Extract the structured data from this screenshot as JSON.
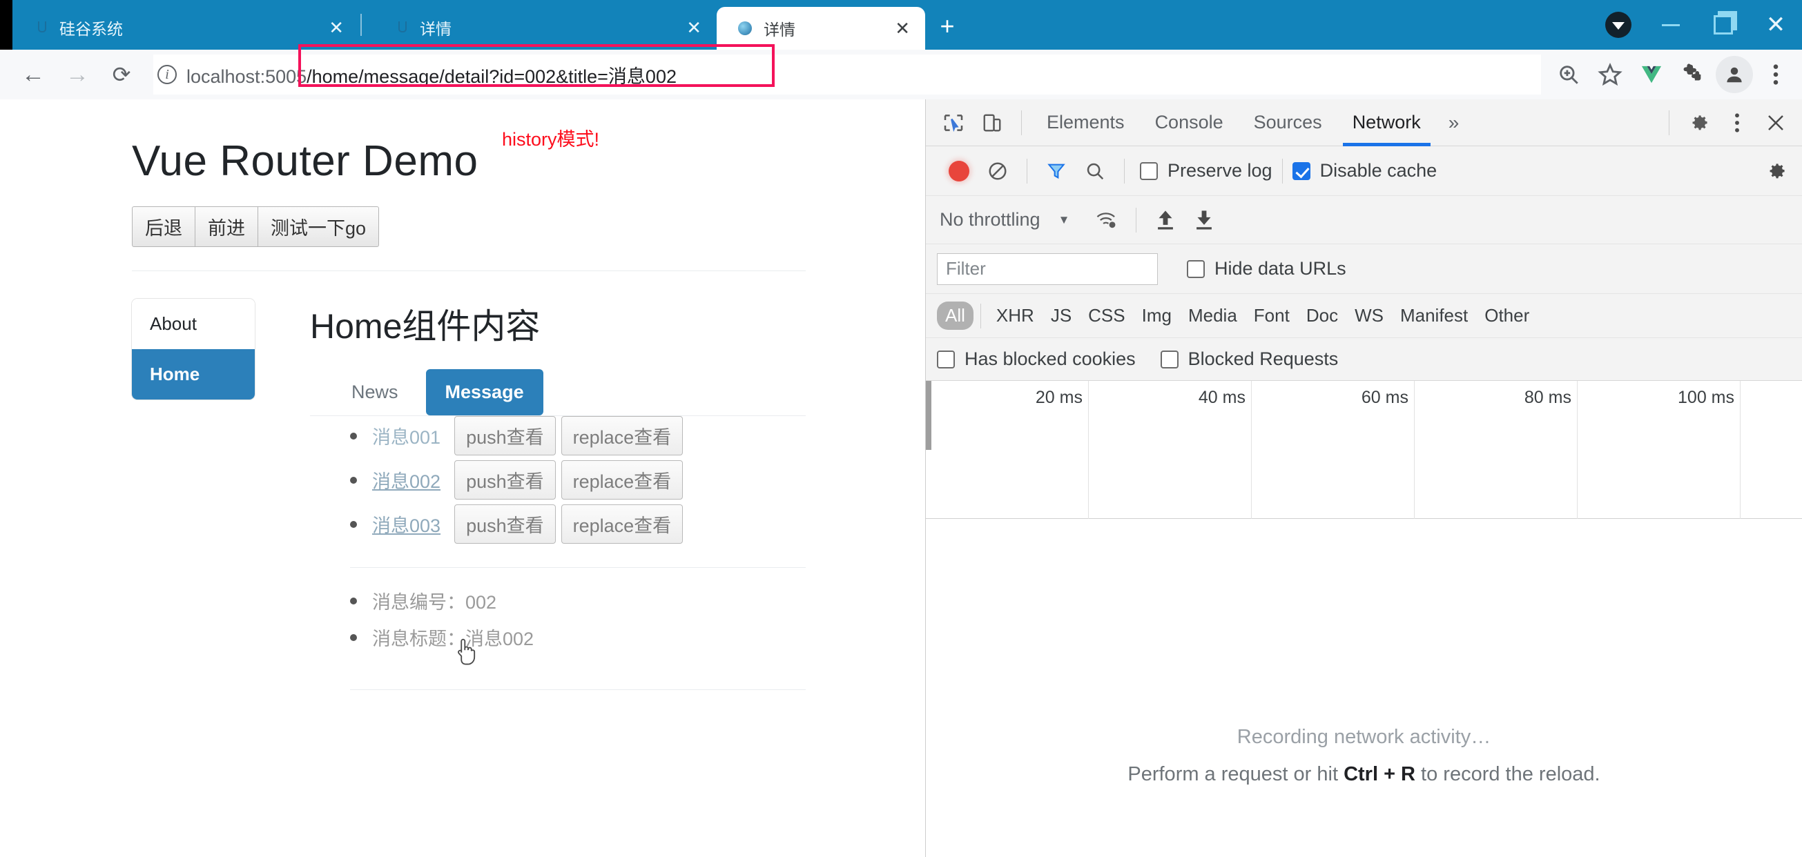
{
  "browser": {
    "tabs": [
      {
        "title": "硅谷系统",
        "favicon": "u-logo-icon",
        "active": false,
        "close_label": "✕"
      },
      {
        "title": "详情",
        "favicon": "u-logo-icon",
        "active": false,
        "close_label": "✕"
      },
      {
        "title": "详情",
        "favicon": "globe-icon",
        "active": true,
        "close_label": "✕"
      }
    ],
    "new_tab_label": "+",
    "window_controls": {
      "minimize": "—",
      "maximize": "❐",
      "close": "✕"
    },
    "nav": {
      "back": "←",
      "forward": "→",
      "reload": "⟳"
    },
    "omnibox": {
      "info_icon": "ⓘ",
      "host": "localhost:5005",
      "path": "/home/message/detail?id=002&title=消息002",
      "full_url": "localhost:5005/home/message/detail?id=002&title=消息002",
      "annotation_color": "#f4125a"
    },
    "toolbar_icons": [
      "zoom-in-icon",
      "bookmark-star-icon",
      "vue-devtools-icon",
      "extensions-puzzle-icon",
      "profile-avatar-icon",
      "chrome-menu-icon"
    ]
  },
  "page": {
    "site_title": "Vue Router Demo",
    "annotation": "history模式!",
    "annotation_color": "#fd0d1c",
    "history_buttons": [
      {
        "label": "后退"
      },
      {
        "label": "前进"
      },
      {
        "label": "测试一下go"
      }
    ],
    "sidebar": {
      "items": [
        {
          "label": "About",
          "active": false
        },
        {
          "label": "Home",
          "active": true
        }
      ]
    },
    "main": {
      "heading": "Home组件内容",
      "tabs": [
        {
          "label": "News",
          "active": false
        },
        {
          "label": "Message",
          "active": true
        }
      ],
      "messages": [
        {
          "label": "消息001",
          "push_label": "push查看",
          "replace_label": "replace查看",
          "visited": false
        },
        {
          "label": "消息002",
          "push_label": "push查看",
          "replace_label": "replace查看",
          "visited": true
        },
        {
          "label": "消息003",
          "push_label": "push查看",
          "replace_label": "replace查看",
          "visited": true
        }
      ],
      "detail": [
        {
          "text": "消息编号：002"
        },
        {
          "text": "消息标题：消息002"
        }
      ]
    },
    "accent_color": "#2c80ba"
  },
  "devtools": {
    "left_icons": [
      "inspect-element-icon",
      "device-toolbar-icon"
    ],
    "tabs": [
      {
        "label": "Elements",
        "active": false
      },
      {
        "label": "Console",
        "active": false
      },
      {
        "label": "Sources",
        "active": false
      },
      {
        "label": "Network",
        "active": true
      }
    ],
    "more_tabs_label": "»",
    "right_icons": [
      "settings-gear-icon",
      "devtools-menu-icon",
      "close-devtools-icon"
    ],
    "active_tab_underline_color": "#1a73e8",
    "network": {
      "record_label": "record-button",
      "clear_label": "clear-button",
      "filter_toggle_label": "filter-toggle",
      "search_label": "search-button",
      "preserve_log": {
        "label": "Preserve log",
        "checked": false
      },
      "disable_cache": {
        "label": "Disable cache",
        "checked": true
      },
      "throttling": {
        "value": "No throttling",
        "caret": "▼"
      },
      "filter_input": {
        "placeholder": "Filter",
        "value": ""
      },
      "hide_data_urls": {
        "label": "Hide data URLs",
        "checked": false
      },
      "type_filters": [
        {
          "label": "All",
          "selected": true
        },
        {
          "label": "XHR",
          "selected": false
        },
        {
          "label": "JS",
          "selected": false
        },
        {
          "label": "CSS",
          "selected": false
        },
        {
          "label": "Img",
          "selected": false
        },
        {
          "label": "Media",
          "selected": false
        },
        {
          "label": "Font",
          "selected": false
        },
        {
          "label": "Doc",
          "selected": false
        },
        {
          "label": "WS",
          "selected": false
        },
        {
          "label": "Manifest",
          "selected": false
        },
        {
          "label": "Other",
          "selected": false
        }
      ],
      "has_blocked_cookies": {
        "label": "Has blocked cookies",
        "checked": false
      },
      "blocked_requests": {
        "label": "Blocked Requests",
        "checked": false
      },
      "timeline_ticks": [
        "20 ms",
        "40 ms",
        "60 ms",
        "80 ms",
        "100 ms"
      ],
      "empty_state": {
        "line1": "Recording network activity…",
        "line2_pre": "Perform a request or hit ",
        "line2_key": "Ctrl + R",
        "line2_post": " to record the reload."
      }
    }
  }
}
